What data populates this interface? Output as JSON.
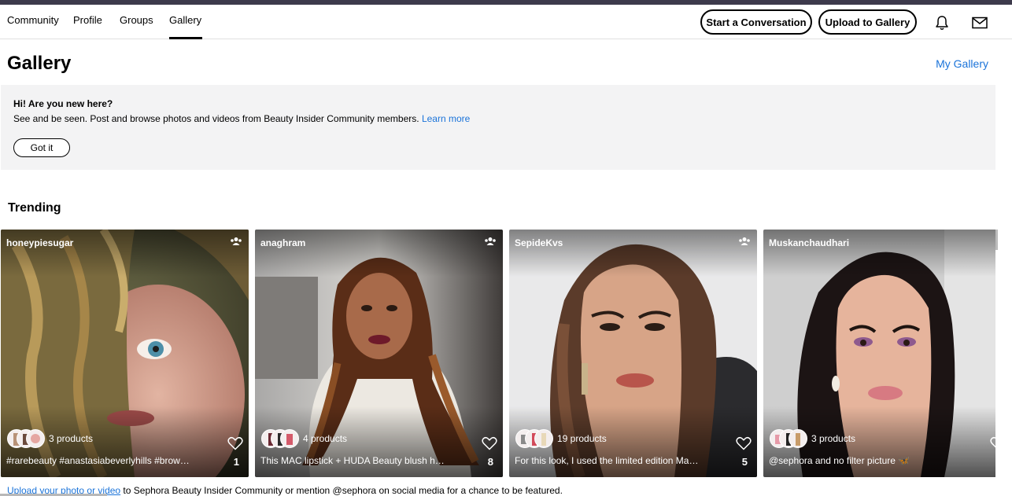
{
  "nav": {
    "tabs": [
      {
        "label": "Community"
      },
      {
        "label": "Profile"
      },
      {
        "label": "Groups"
      },
      {
        "label": "Gallery",
        "active": true
      }
    ],
    "start_conversation": "Start a Conversation",
    "upload_gallery": "Upload to Gallery",
    "icons": [
      "bell-icon",
      "mail-icon"
    ]
  },
  "page": {
    "title": "Gallery",
    "my_gallery": "My Gallery"
  },
  "banner": {
    "heading": "Hi! Are you new here?",
    "text": "See and be seen. Post and browse photos and videos from Beauty Insider Community members.",
    "link": "Learn more",
    "button": "Got it"
  },
  "trending": {
    "title": "Trending",
    "cards": [
      {
        "user": "honeypiesugar",
        "products": "3 products",
        "caption": "#rarebeauty #anastasiabeverlyhills #brow…",
        "likes": "1"
      },
      {
        "user": "anaghram",
        "products": "4 products",
        "caption": "This MAC lipstick + HUDA Beauty blush h…",
        "likes": "8"
      },
      {
        "user": "SepideKvs",
        "products": "19 products",
        "caption": "For this look, I used the limited edition Ma…",
        "likes": "5"
      },
      {
        "user": "Muskanchaudhari",
        "products": "3 products",
        "caption": "@sephora and no filter picture 🦋",
        "likes": ""
      }
    ]
  },
  "footer": {
    "link": "Upload your photo or video",
    "text": " to Sephora Beauty Insider Community or mention @sephora on social media for a chance to be featured."
  },
  "colors": {
    "accent_link": "#1a73d9",
    "top_bar": "#3d3a4c",
    "banner_bg": "#f3f3f4"
  }
}
